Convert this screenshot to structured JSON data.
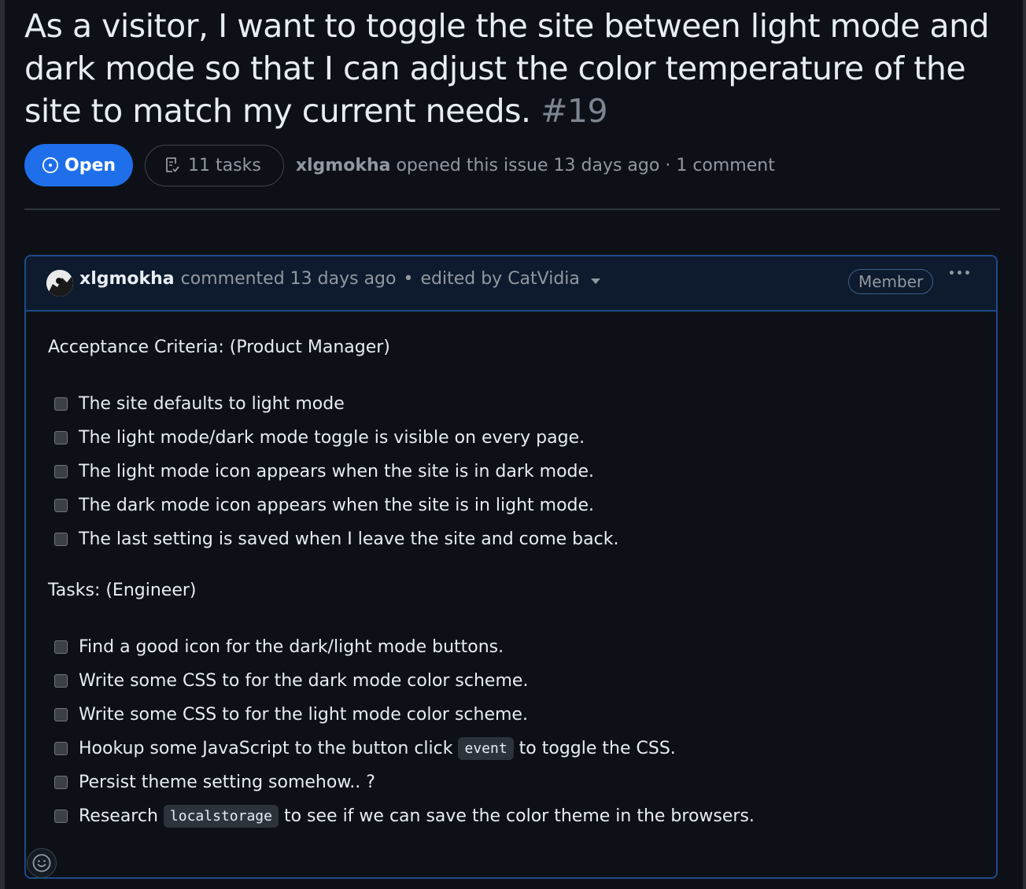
{
  "issue": {
    "title": "As a visitor, I want to toggle the site between light mode and dark mode so that I can adjust the color temperature of the site to match my current needs.",
    "number": "#19",
    "state": "Open",
    "tasks_summary": "11 tasks",
    "author": "xlgmokha",
    "opened_text": "opened this issue 13 days ago",
    "separator": "·",
    "comment_count": "1 comment"
  },
  "comment": {
    "author": "xlgmokha",
    "commented_text": "commented 13 days ago",
    "separator": "•",
    "edited_text": "edited by CatVidia",
    "role_badge": "Member",
    "sections": [
      {
        "heading": "Acceptance Criteria: (Product Manager)",
        "items": [
          {
            "text": "The site defaults to light mode",
            "checked": false
          },
          {
            "text": "The light mode/dark mode toggle is visible on every page.",
            "checked": false
          },
          {
            "text": "The light mode icon appears when the site is in dark mode.",
            "checked": false
          },
          {
            "text": "The dark mode icon appears when the site is in light mode.",
            "checked": false
          },
          {
            "text": "The last setting is saved when I leave the site and come back.",
            "checked": false
          }
        ]
      },
      {
        "heading": "Tasks: (Engineer)",
        "items": [
          {
            "text": "Find a good icon for the dark/light mode buttons.",
            "checked": false
          },
          {
            "text": "Write some CSS to for the dark mode color scheme.",
            "checked": false
          },
          {
            "text": "Write some CSS to for the light mode color scheme.",
            "checked": false
          },
          {
            "before": "Hookup some JavaScript to the button click",
            "code": "event",
            "after": "to toggle the CSS.",
            "checked": false
          },
          {
            "text": "Persist theme setting somehow.. ?",
            "checked": false
          },
          {
            "before": "Research",
            "code": "localstorage",
            "after": "to see if we can save the color theme in the browsers.",
            "checked": false
          }
        ]
      }
    ]
  },
  "icons": {
    "state": "issue-open-icon",
    "tasks": "checklist-icon",
    "caret": "chevron-down-icon",
    "menu": "kebab-horizontal-icon",
    "reaction": "smiley-icon"
  },
  "colors": {
    "background": "#0d1117",
    "accent": "#1f6feb",
    "muted_text": "#9198a1",
    "comment_border": "#1f4a8a",
    "comment_header_bg": "#0e1b2e"
  }
}
